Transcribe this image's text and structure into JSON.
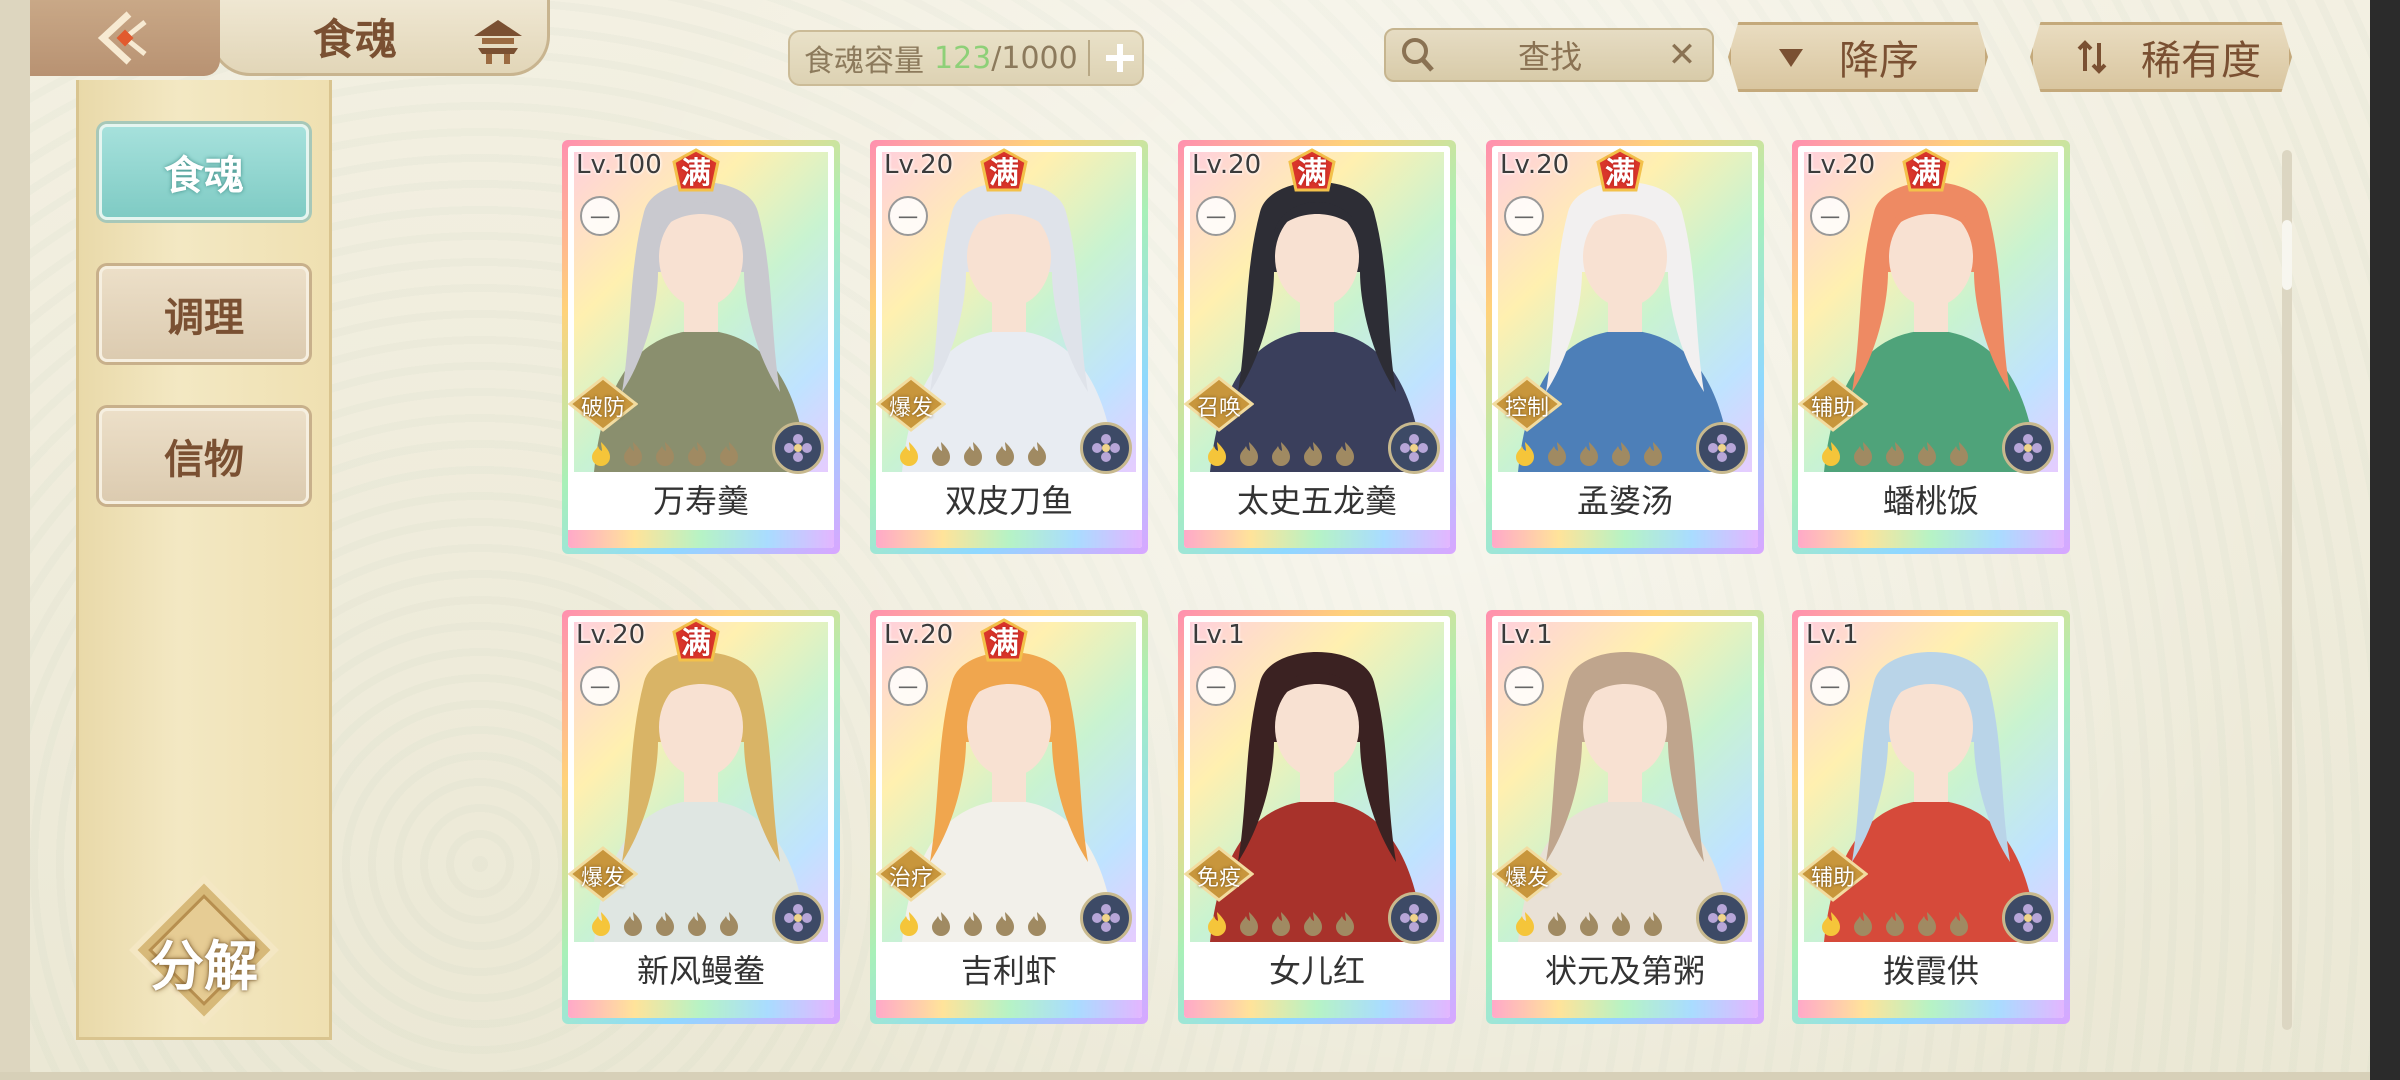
{
  "header": {
    "title": "食魂",
    "capacity": {
      "label": "食魂容量",
      "current": "123",
      "separator": "/",
      "max": "1000"
    },
    "search": {
      "label": "查找"
    },
    "sort_order": {
      "label": "降序"
    },
    "sort_by": {
      "label": "稀有度"
    }
  },
  "sidebar": {
    "tabs": [
      {
        "label": "食魂",
        "active": true
      },
      {
        "label": "调理",
        "active": false
      },
      {
        "label": "信物",
        "active": false
      }
    ],
    "decompose_label": "分解"
  },
  "cards": [
    {
      "level": "Lv.100",
      "full_badge": "满",
      "grade": "一",
      "role": "破防",
      "name": "万寿羹",
      "hair": "#c9c9cf",
      "outfit": "#8a8f6e"
    },
    {
      "level": "Lv.20",
      "full_badge": "满",
      "grade": "一",
      "role": "爆发",
      "name": "双皮刀鱼",
      "hair": "#dfe3ea",
      "outfit": "#e8ecf2"
    },
    {
      "level": "Lv.20",
      "full_badge": "满",
      "grade": "一",
      "role": "召唤",
      "name": "太史五龙羹",
      "hair": "#2d2d35",
      "outfit": "#3a3f5c"
    },
    {
      "level": "Lv.20",
      "full_badge": "满",
      "grade": "一",
      "role": "控制",
      "name": "孟婆汤",
      "hair": "#f2f0f0",
      "outfit": "#4d7fb8"
    },
    {
      "level": "Lv.20",
      "full_badge": "满",
      "grade": "一",
      "role": "辅助",
      "name": "蟠桃饭",
      "hair": "#ee8a63",
      "outfit": "#4fa37a"
    },
    {
      "level": "Lv.20",
      "full_badge": "满",
      "grade": "一",
      "role": "爆发",
      "name": "新风鳗鲞",
      "hair": "#d9b466",
      "outfit": "#dfe6e2"
    },
    {
      "level": "Lv.20",
      "full_badge": "满",
      "grade": "一",
      "role": "治疗",
      "name": "吉利虾",
      "hair": "#f0a64e",
      "outfit": "#f2f0ea"
    },
    {
      "level": "Lv.1",
      "full_badge": "",
      "grade": "一",
      "role": "免疫",
      "name": "女儿红",
      "hair": "#3b2222",
      "outfit": "#a8322b"
    },
    {
      "level": "Lv.1",
      "full_badge": "",
      "grade": "一",
      "role": "爆发",
      "name": "状元及第粥",
      "hair": "#bfa58d",
      "outfit": "#e9e1d6"
    },
    {
      "level": "Lv.1",
      "full_badge": "",
      "grade": "一",
      "role": "辅助",
      "name": "拨霞供",
      "hair": "#b9d4e8",
      "outfit": "#d64a3a"
    }
  ]
}
